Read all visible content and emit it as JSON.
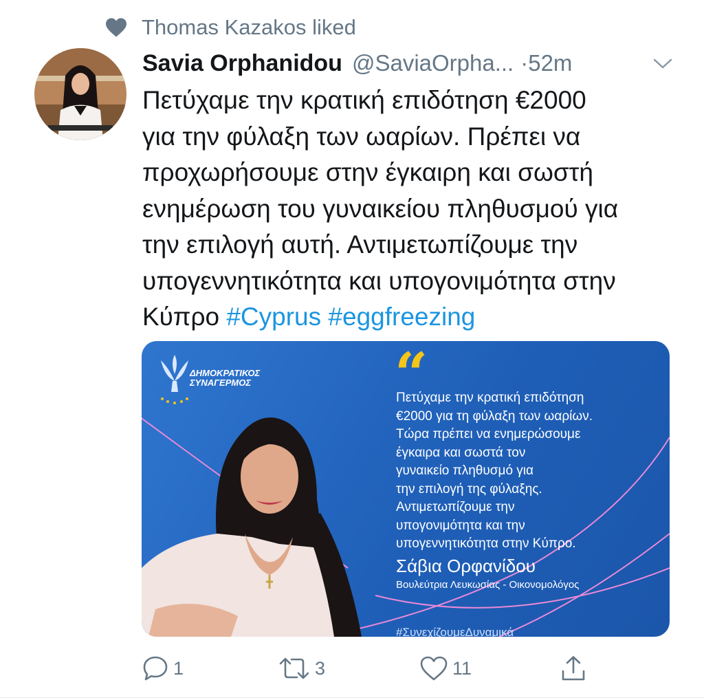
{
  "social_context": {
    "icon": "heart-icon",
    "text": "Thomas Kazakos liked"
  },
  "tweet": {
    "author_name": "Savia Orphanidou",
    "handle": "@SaviaOrpha...",
    "time": "·52m",
    "text_lines": [
      "Πετύχαμε την κρατική επιδότηση €2000",
      "για την φύλαξη των ωαρίων. Πρέπει να",
      "προχωρήσουμε στην έγκαιρη και σωστή",
      "ενημέρωση του γυναικείου πληθυσμού για",
      "την επιλογή αυτή. Αντιμετωπίζουμε την",
      "υπογεννητικότητα και υπογονιμότητα στην"
    ],
    "last_line_text": "Κύπρο",
    "hashtags": [
      "#Cyprus",
      "#eggfreezing"
    ],
    "hashtag_color": "#1b95e0"
  },
  "media_card": {
    "party_name_line1": "ΔΗΜΟΚΡΑΤΙΚΟΣ",
    "party_name_line2": "ΣΥΝΑΓΕΡΜΟΣ",
    "quote_mark": "“",
    "quote_lines": [
      "Πετύχαμε την κρατική επιδότηση",
      "€2000 για τη φύλαξη των ωαρίων.",
      "Τώρα πρέπει να ενημερώσουμε",
      "έγκαιρα και σωστά τον",
      "γυναικείο πληθυσμό για",
      "την επιλογή της φύλαξης.",
      "Αντιμετωπίζουμε την",
      "υπογονιμότητα και την",
      "υπογεννητικότητα στην Κύπρο."
    ],
    "signature_name": "Σάβια Ορφανίδου",
    "signature_role": "Βουλεύτρια Λευκωσίας - Οικονομολόγος",
    "bottom_tag": "#ΣυνεχίζουμεΔυναμικά",
    "accent_color": "#f5c518",
    "background_color": "#2466c0"
  },
  "actions": {
    "reply_count": "1",
    "retweet_count": "3",
    "like_count": "11"
  }
}
